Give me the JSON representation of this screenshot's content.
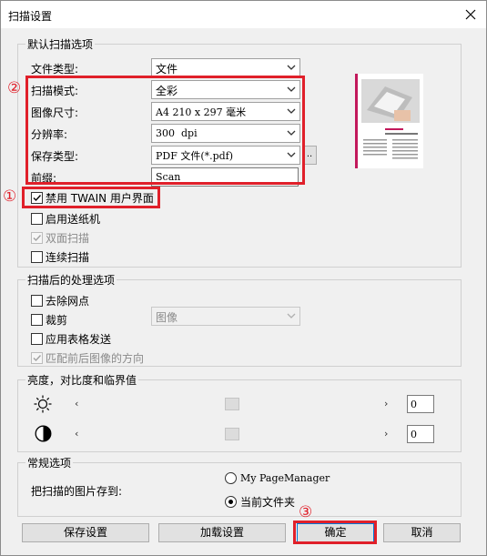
{
  "window": {
    "title": "扫描设置"
  },
  "default_scan_options": {
    "legend": "默认扫描选项",
    "file_type": {
      "label": "文件类型:",
      "value": "文件"
    },
    "scan_mode": {
      "label": "扫描模式:",
      "value": "全彩"
    },
    "image_size": {
      "label": "图像尺寸:",
      "value": "A4 210 x 297 毫米"
    },
    "resolution": {
      "label": "分辨率:",
      "value": "300  dpi"
    },
    "save_type": {
      "label": "保存类型:",
      "value": "PDF 文件(*.pdf)",
      "browse_label": ".."
    },
    "prefix": {
      "label": "前缀:",
      "value": "Scan"
    },
    "checkboxes": [
      {
        "label": "禁用 TWAIN 用户界面",
        "checked": true,
        "enabled": true
      },
      {
        "label": "启用送纸机",
        "checked": false,
        "enabled": true
      },
      {
        "label": "双面扫描",
        "checked": true,
        "enabled": false
      },
      {
        "label": "连续扫描",
        "checked": false,
        "enabled": true
      }
    ]
  },
  "post_scan": {
    "legend": "扫描后的处理选项",
    "despeckle": {
      "label": "去除网点",
      "checked": false
    },
    "crop": {
      "label": "裁剪",
      "checked": false,
      "combo_value": "图像"
    },
    "apply_table": {
      "label": "应用表格发送",
      "checked": false
    },
    "match_direction": {
      "label": "匹配前后图像的方向",
      "checked": true,
      "enabled": false
    }
  },
  "brightness": {
    "legend": "亮度，对比度和临界值",
    "brightness_value": "0",
    "contrast_value": "0",
    "left_arrow": "‹",
    "right_arrow": "›"
  },
  "general": {
    "legend": "常规选项",
    "save_to_label": "把扫描的图片存到:",
    "options": [
      {
        "label": "My PageManager",
        "selected": false
      },
      {
        "label": "当前文件夹",
        "selected": true
      }
    ]
  },
  "buttons": {
    "save_settings": "保存设置",
    "load_settings": "加载设置",
    "ok": "确定",
    "cancel": "取消"
  },
  "markers": {
    "one": "①",
    "two": "②",
    "three": "③"
  },
  "colors": {
    "annotation_red": "#e0202a",
    "thumbnail_accent": "#c2185b"
  }
}
